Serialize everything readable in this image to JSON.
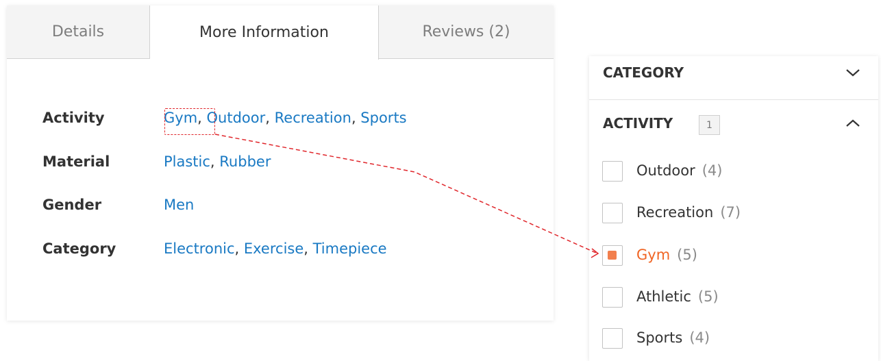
{
  "tabs": [
    {
      "label": "Details",
      "active": false
    },
    {
      "label": "More Information",
      "active": true
    },
    {
      "label": "Reviews (2)",
      "active": false
    }
  ],
  "more_info": {
    "rows": [
      {
        "label": "Activity",
        "values": [
          "Gym",
          "Outdoor",
          "Recreation",
          "Sports"
        ]
      },
      {
        "label": "Material",
        "values": [
          "Plastic",
          "Rubber"
        ]
      },
      {
        "label": "Gender",
        "values": [
          "Men"
        ]
      },
      {
        "label": "Category",
        "values": [
          "Electronic",
          "Exercise",
          "Timepiece"
        ]
      }
    ],
    "separator": ", "
  },
  "filters": {
    "category": {
      "title": "CATEGORY",
      "icon": "chevron-down-icon"
    },
    "activity": {
      "title": "ACTIVITY",
      "selected_count": "1",
      "icon": "chevron-up-icon",
      "options": [
        {
          "name": "Outdoor",
          "count": "(4)",
          "checked": false
        },
        {
          "name": "Recreation",
          "count": "(7)",
          "checked": false
        },
        {
          "name": "Gym",
          "count": "(5)",
          "checked": true
        },
        {
          "name": "Athletic",
          "count": "(5)",
          "checked": false
        },
        {
          "name": "Sports",
          "count": "(4)",
          "checked": false
        }
      ]
    }
  },
  "colors": {
    "link": "#1979c3",
    "selected": "#f06524",
    "checkbox_fill": "#f27f4d",
    "annotation": "#e0262b"
  }
}
